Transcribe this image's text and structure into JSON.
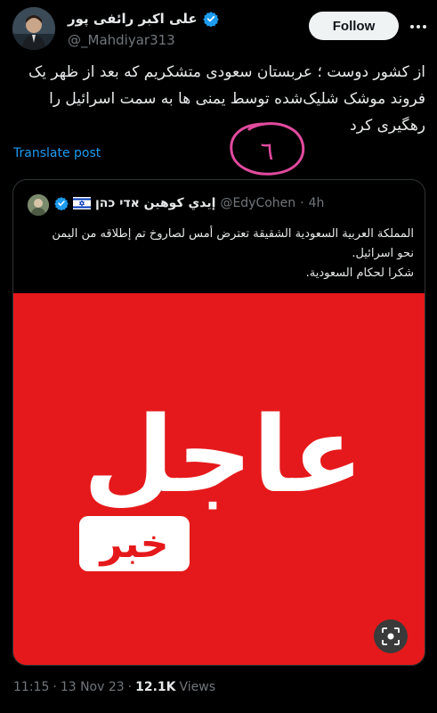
{
  "author": {
    "display_name": "علی اکبر رائفی پور",
    "handle": "@_Mahdiyar313",
    "verified": true,
    "avatar_icon": "profile-photo"
  },
  "actions": {
    "follow_label": "Follow",
    "more_icon": "ellipsis-icon"
  },
  "post": {
    "text": "از کشور دوست ؛ عربستان سعودی متشکریم که بعد از ظهر یک فروند موشک شلیک‌شده توسط یمنی ها به سمت اسرائیل را رهگیری کرد",
    "translate_label": "Translate post",
    "annotation": "٦"
  },
  "quote": {
    "display_name": "إيدي كوهين אדי כהן",
    "handle": "@EdyCohen",
    "time": "4h",
    "verified": true,
    "flag_icon": "israel-flag-icon",
    "text_lines": [
      "المملكة العربية السعودية الشقيقة تعترض أمس لصاروخ تم إطلاقه من اليمن",
      "نحو اسرائيل.",
      "شكرا لحكام السعودية."
    ],
    "image": {
      "main_word": "عاجل",
      "tag_word": "خبر",
      "background": "#e5191b"
    },
    "lens_icon": "image-search-icon"
  },
  "footer": {
    "time": "11:15",
    "date": "13 Nov 23",
    "views_count": "12.1K",
    "views_label": "Views",
    "separator": "·"
  }
}
